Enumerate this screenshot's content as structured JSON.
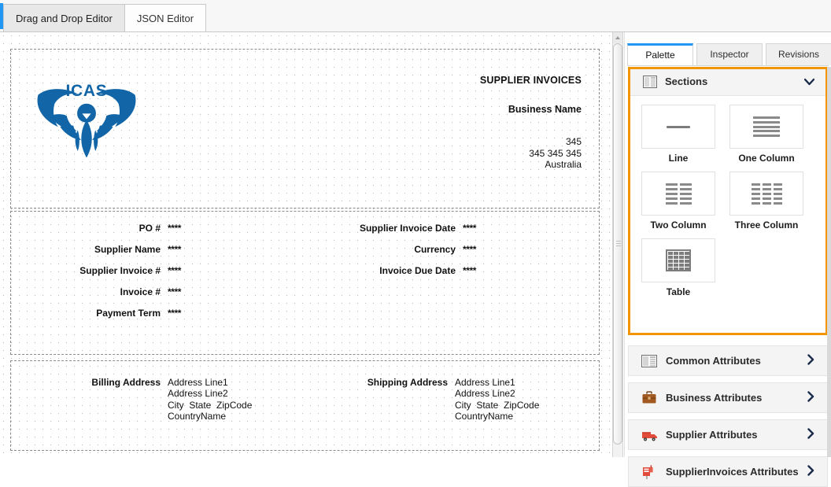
{
  "topbar": {
    "tabs": [
      {
        "label": "Drag and Drop Editor",
        "active": true
      },
      {
        "label": "JSON Editor",
        "active": false
      }
    ]
  },
  "canvas": {
    "logo": {
      "icon": "icas-phoenix-logo",
      "text": "ICAS",
      "color": "#1266a8"
    },
    "header": {
      "title": "SUPPLIER INVOICES",
      "business_name": "Business Name",
      "address_line1": "345",
      "address_line2": "345  345  345",
      "country": "Australia"
    },
    "fields_left": [
      {
        "label": "PO #",
        "value": "****"
      },
      {
        "label": "Supplier Name",
        "value": "****"
      },
      {
        "label": "Supplier Invoice #",
        "value": "****"
      },
      {
        "label": "Invoice #",
        "value": "****"
      },
      {
        "label": "Payment Term",
        "value": "****"
      }
    ],
    "fields_right": [
      {
        "label": "Supplier Invoice Date",
        "value": "****"
      },
      {
        "label": "Currency",
        "value": "****"
      },
      {
        "label": "Invoice Due Date",
        "value": "****"
      }
    ],
    "addresses": [
      {
        "label": "Billing Address",
        "lines": "Address Line1\nAddress Line2\nCity  State  ZipCode\nCountryName"
      },
      {
        "label": "Shipping Address",
        "lines": "Address Line1\nAddress Line2\nCity  State  ZipCode\nCountryName"
      }
    ]
  },
  "right_panel": {
    "tabs": [
      {
        "label": "Palette",
        "active": true
      },
      {
        "label": "Inspector",
        "active": false
      },
      {
        "label": "Revisions",
        "active": false
      }
    ],
    "accent_color": "#f29500",
    "active_tab_color": "#2196f3",
    "sections": {
      "title": "Sections",
      "icon": "sections-icon",
      "chevron": "chevron-down-icon",
      "items": [
        {
          "label": "Line",
          "icon": "line-icon"
        },
        {
          "label": "One Column",
          "icon": "one-column-icon"
        },
        {
          "label": "Two Column",
          "icon": "two-column-icon"
        },
        {
          "label": "Three Column",
          "icon": "three-column-icon"
        },
        {
          "label": "Table",
          "icon": "table-icon"
        }
      ]
    },
    "accordions": [
      {
        "label": "Common Attributes",
        "icon": "newspaper-icon",
        "chevron": "chevron-right-icon"
      },
      {
        "label": "Business Attributes",
        "icon": "briefcase-icon",
        "chevron": "chevron-right-icon"
      },
      {
        "label": "Supplier Attributes",
        "icon": "truck-icon",
        "chevron": "chevron-right-icon"
      },
      {
        "label": "SupplierInvoices Attributes",
        "icon": "mailbox-icon",
        "chevron": "chevron-right-icon"
      }
    ]
  }
}
